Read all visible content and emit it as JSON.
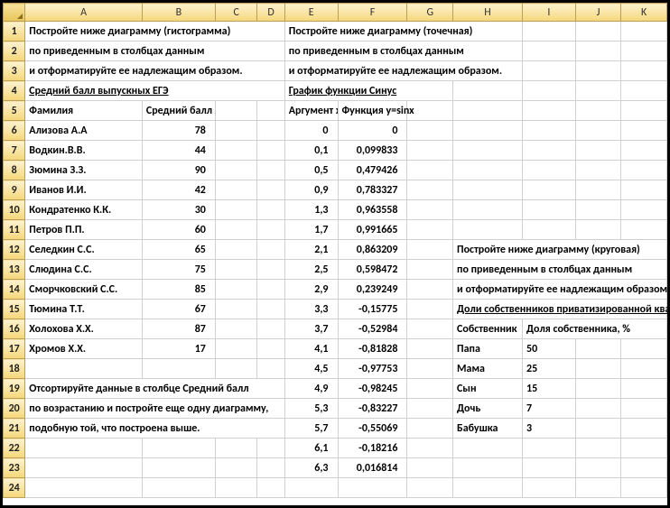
{
  "columns": [
    "A",
    "B",
    "C",
    "D",
    "E",
    "F",
    "G",
    "H",
    "I",
    "J",
    "K"
  ],
  "rows": [
    "1",
    "2",
    "3",
    "4",
    "5",
    "6",
    "7",
    "8",
    "9",
    "10",
    "11",
    "12",
    "13",
    "14",
    "15",
    "16",
    "17",
    "18",
    "19",
    "20",
    "21",
    "22",
    "23",
    "24"
  ],
  "task1": {
    "l1": "Постройте ниже диаграмму (гистограмма)",
    "l2": "по приведенным в столбцах данным",
    "l3": "и отформатируйте ее надлежащим образом.",
    "title": "Средний балл выпускных ЕГЭ",
    "h1": "Фамилия",
    "h2": "Средний балл",
    "rowsData": [
      {
        "name": "Ализова А.А",
        "val": "78"
      },
      {
        "name": "Водкин.В.В.",
        "val": "44"
      },
      {
        "name": "Зюмина З.З.",
        "val": "90"
      },
      {
        "name": "Иванов И.И.",
        "val": "42"
      },
      {
        "name": "Кондратенко К.К.",
        "val": "30"
      },
      {
        "name": "Петров П.П.",
        "val": "60"
      },
      {
        "name": "Селедкин С.С.",
        "val": "65"
      },
      {
        "name": "Слюдина С.С.",
        "val": "75"
      },
      {
        "name": "Сморчковский С.С.",
        "val": "85"
      },
      {
        "name": "Тюмина Т.Т.",
        "val": "67"
      },
      {
        "name": "Холохова Х.Х.",
        "val": "87"
      },
      {
        "name": "Хромов Х.Х.",
        "val": "17"
      }
    ],
    "s1": "Отсортируйте данные в столбце Средний балл",
    "s2": "по возрастанию и постройте еще одну диаграмму,",
    "s3": "подобную той, что построена выше."
  },
  "task2": {
    "l1": "Постройте ниже диаграмму (точечная)",
    "l2": "по приведенным в столбцах данным",
    "l3": "и отформатируйте ее надлежащим образом.",
    "title": "График функции Синус",
    "h1": "Аргумент х",
    "h2": "Функция y=sinx",
    "rowsData": [
      {
        "x": "0",
        "y": "0"
      },
      {
        "x": "0,1",
        "y": "0,099833"
      },
      {
        "x": "0,5",
        "y": "0,479426"
      },
      {
        "x": "0,9",
        "y": "0,783327"
      },
      {
        "x": "1,3",
        "y": "0,963558"
      },
      {
        "x": "1,7",
        "y": "0,991665"
      },
      {
        "x": "2,1",
        "y": "0,863209"
      },
      {
        "x": "2,5",
        "y": "0,598472"
      },
      {
        "x": "2,9",
        "y": "0,239249"
      },
      {
        "x": "3,3",
        "y": "-0,15775"
      },
      {
        "x": "3,7",
        "y": "-0,52984"
      },
      {
        "x": "4,1",
        "y": "-0,81828"
      },
      {
        "x": "4,5",
        "y": "-0,97753"
      },
      {
        "x": "4,9",
        "y": "-0,98245"
      },
      {
        "x": "5,3",
        "y": "-0,83227"
      },
      {
        "x": "5,7",
        "y": "-0,55069"
      },
      {
        "x": "6,1",
        "y": "-0,18216"
      },
      {
        "x": "6,3",
        "y": "0,016814"
      }
    ]
  },
  "task3": {
    "l1": "Постройте ниже диаграмму (круговая)",
    "l2": "по приведенным в столбцах данным",
    "l3": "и отформатируйте ее надлежащим образом.",
    "title": "Доли собственников приватизированной квартиры",
    "h1": "Собственник",
    "h2": "Доля собственника, %",
    "rowsData": [
      {
        "name": "Папа",
        "val": "50"
      },
      {
        "name": "Мама",
        "val": "25"
      },
      {
        "name": "Сын",
        "val": "15"
      },
      {
        "name": "Дочь",
        "val": "7"
      },
      {
        "name": "Бабушка",
        "val": "3"
      }
    ]
  },
  "chart_data": [
    {
      "type": "bar",
      "title": "Средний балл выпускных ЕГЭ",
      "xlabel": "Фамилия",
      "ylabel": "Средний балл",
      "categories": [
        "Ализова А.А",
        "Водкин.В.В.",
        "Зюмина З.З.",
        "Иванов И.И.",
        "Кондратенко К.К.",
        "Петров П.П.",
        "Селедкин С.С.",
        "Слюдина С.С.",
        "Сморчковский С.С.",
        "Тюмина Т.Т.",
        "Холохова Х.Х.",
        "Хромов Х.Х."
      ],
      "values": [
        78,
        44,
        90,
        42,
        30,
        60,
        65,
        75,
        85,
        67,
        87,
        17
      ]
    },
    {
      "type": "scatter",
      "title": "График функции Синус",
      "xlabel": "Аргумент х",
      "ylabel": "Функция y=sinx",
      "x": [
        0,
        0.1,
        0.5,
        0.9,
        1.3,
        1.7,
        2.1,
        2.5,
        2.9,
        3.3,
        3.7,
        4.1,
        4.5,
        4.9,
        5.3,
        5.7,
        6.1,
        6.3
      ],
      "values": [
        0,
        0.099833,
        0.479426,
        0.783327,
        0.963558,
        0.991665,
        0.863209,
        0.598472,
        0.239249,
        -0.15775,
        -0.52984,
        -0.81828,
        -0.97753,
        -0.98245,
        -0.83227,
        -0.55069,
        -0.18216,
        0.016814
      ]
    },
    {
      "type": "pie",
      "title": "Доли собственников приватизированной квартиры",
      "categories": [
        "Папа",
        "Мама",
        "Сын",
        "Дочь",
        "Бабушка"
      ],
      "values": [
        50,
        25,
        15,
        7,
        3
      ]
    }
  ]
}
